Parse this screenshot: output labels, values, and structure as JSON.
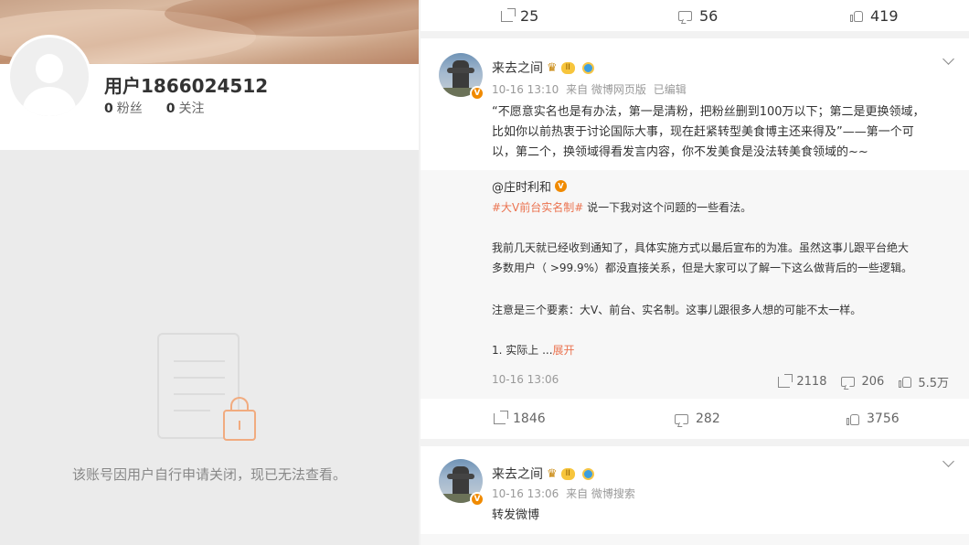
{
  "profile": {
    "username": "用户1866024512",
    "followers_count": "0",
    "followers_label": "粉丝",
    "following_count": "0",
    "following_label": "关注",
    "closed_message": "该账号因用户自行申请关闭，现已无法查看。"
  },
  "top_actions": {
    "repost": "25",
    "comment": "56",
    "like": "419"
  },
  "post1": {
    "author": "来去之间",
    "level": "II",
    "time": "10-16 13:10",
    "source": "来自 微博网页版",
    "edited": "已编辑",
    "text_lines": [
      "“不愿意实名也是有办法，第一是清粉，把粉丝删到100万以下；第二是更换领域，",
      "比如你以前热衷于讨论国际大事，现在赶紧转型美食博主还来得及”——第一个可",
      "以，第二个，换领域得看发言内容，你不发美食是没法转美食领域的~~"
    ],
    "repost": {
      "user": "@庄时利和",
      "hashtag": "#大V前台实名制#",
      "line1_rest": " 说一下我对这个问题的一些看法。",
      "line2": "我前几天就已经收到通知了，具体实施方式以最后宣布的为准。虽然这事儿跟平台绝大",
      "line3": "多数用户（ >99.9%）都没直接关系，但是大家可以了解一下这么做背后的一些逻辑。",
      "line4": "注意是三个要素：大V、前台、实名制。这事儿跟很多人想的可能不太一样。",
      "line5": "1. 实际上 ...",
      "more": "展开",
      "time": "10-16 13:06",
      "reposts": "2118",
      "comments": "206",
      "likes": "5.5万"
    },
    "actions": {
      "repost": "1846",
      "comment": "282",
      "like": "3756"
    }
  },
  "post2": {
    "author": "来去之间",
    "level": "II",
    "time": "10-16 13:06",
    "source": "来自 微博搜索",
    "text": "转发微博"
  },
  "colors": {
    "accent": "#eb7350",
    "verified_orange": "#f08a00"
  }
}
